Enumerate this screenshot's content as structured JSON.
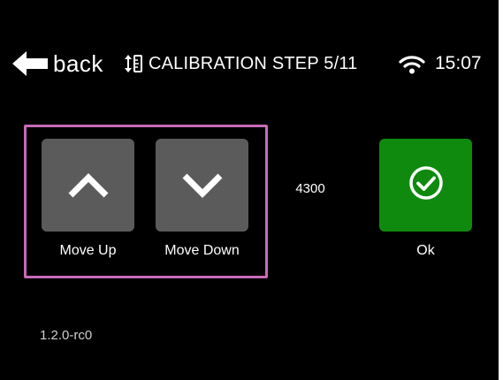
{
  "header": {
    "back_label": "back",
    "back_icon": "arrow-left-icon",
    "title_icon": "calibration-icon",
    "title": "CALIBRATION STEP 5/11",
    "wifi_icon": "wifi-icon",
    "time": "15:07"
  },
  "controls": {
    "move_up": {
      "label": "Move Up",
      "icon": "chevron-up-icon"
    },
    "move_down": {
      "label": "Move Down",
      "icon": "chevron-down-icon"
    },
    "ok": {
      "label": "Ok",
      "icon": "check-circle-icon",
      "color": "#0f8a0f"
    }
  },
  "position_value": "4300",
  "version": "1.2.0-rc0",
  "colors": {
    "background": "#000000",
    "tile": "#5b5b5b",
    "ok_tile": "#0f8a0f",
    "highlight_border": "#c86ab6",
    "text": "#ffffff"
  }
}
